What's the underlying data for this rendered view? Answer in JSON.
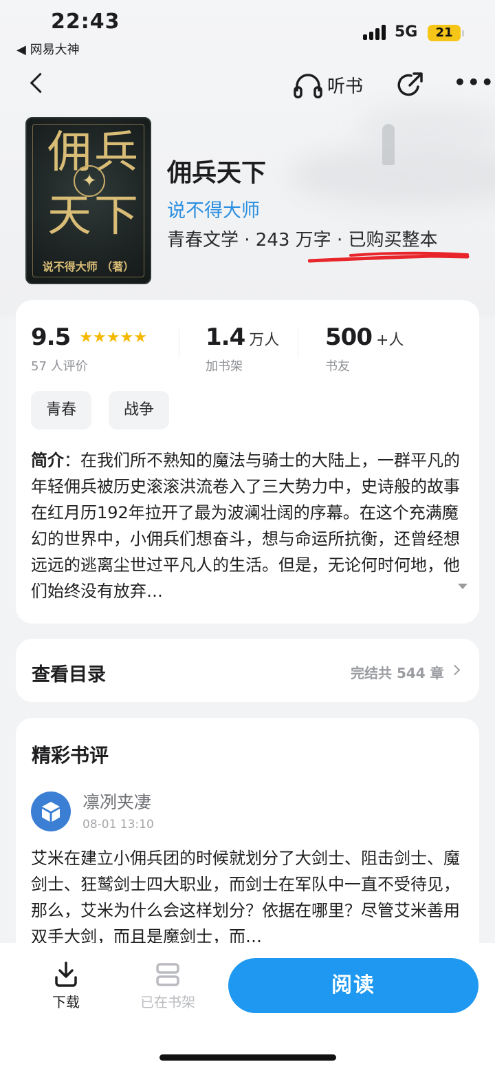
{
  "status_bar": {
    "time": "22:43",
    "back_app": "◀ 网易大神",
    "network": "5G",
    "battery": "21"
  },
  "nav": {
    "listen_label": "听书"
  },
  "book": {
    "cover_title_line1": "佣兵",
    "cover_title_line2": "天下",
    "cover_author": "说不得大师 （著）",
    "title": "佣兵天下",
    "author": "说不得大师",
    "meta": "青春文学 · 243 万字 · 已购买整本"
  },
  "stats": {
    "rating": "9.5",
    "rating_stars": 5,
    "rating_count": "57 人评价",
    "shelf_num": "1.4",
    "shelf_unit": "万人",
    "shelf_label": "加书架",
    "friends_num": "500",
    "friends_unit": "+人",
    "friends_label": "书友"
  },
  "tags": [
    "青春",
    "战争"
  ],
  "intro": {
    "label": "简介",
    "text": "：在我们所不熟知的魔法与骑士的大陆上，一群平凡的年轻佣兵被历史滚滚洪流卷入了三大势力中，史诗般的故事在红月历192年拉开了最为波澜壮阔的序幕。在这个充满魔幻的世界中，小佣兵们想奋斗，想与命运所抗衡，还曾经想远远的逃离尘世过平凡人的生活。但是，无论何时何地，他们始终没有放弃…"
  },
  "toc": {
    "title": "查看目录",
    "info": "完结共 544 章"
  },
  "reviews": {
    "title": "精彩书评",
    "items": [
      {
        "user": "凛冽夹凄",
        "time": "08-01 13:10",
        "text": "艾米在建立小佣兵团的时候就划分了大剑士、阻击剑士、魔剑士、狂鹫剑士四大职业，而剑士在军队中一直不受待见，那么，艾米为什么会这样划分？依据在哪里？尽管艾米善用双手大剑，而且是魔剑士，而…"
      }
    ]
  },
  "bottom": {
    "download_label": "下载",
    "shelf_label": "已在书架",
    "read_label": "阅读"
  },
  "colors": {
    "accent": "#1e98f0",
    "author_link": "#2b8fe0",
    "star": "#f5b800",
    "annotation_red": "#e8252a"
  }
}
